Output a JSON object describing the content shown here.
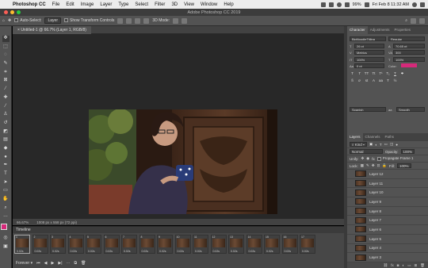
{
  "menubar": {
    "app_name": "Photoshop CC",
    "items": [
      "File",
      "Edit",
      "Image",
      "Layer",
      "Type",
      "Select",
      "Filter",
      "3D",
      "View",
      "Window",
      "Help"
    ],
    "battery": "99%",
    "clock": "Fri Feb 8  11:32 AM"
  },
  "window": {
    "title": "Adobe Photoshop CC 2019"
  },
  "options_bar": {
    "auto_select_label": "Auto-Select:",
    "auto_select_value": "Layer",
    "show_transform_label": "Show Transform Controls",
    "mode_3d_label": "3D Mode:"
  },
  "document": {
    "tab_title": "Untitled-1 @ 66.7% (Layer 1, RGB/8)",
    "zoom": "66.67%",
    "doc_info": "1008 px x 558 px (72 ppi)"
  },
  "timeline": {
    "title": "Timeline",
    "frames": [
      {
        "num": "1",
        "delay": "0.02s"
      },
      {
        "num": "2",
        "delay": "0.02s"
      },
      {
        "num": "3",
        "delay": "0.02s"
      },
      {
        "num": "4",
        "delay": "0.02s"
      },
      {
        "num": "5",
        "delay": "0.02s"
      },
      {
        "num": "6",
        "delay": "0.02s"
      },
      {
        "num": "7",
        "delay": "0.02s"
      },
      {
        "num": "8",
        "delay": "0.02s"
      },
      {
        "num": "9",
        "delay": "0.02s"
      },
      {
        "num": "10",
        "delay": "0.02s"
      },
      {
        "num": "11",
        "delay": "0.02s"
      },
      {
        "num": "12",
        "delay": "0.02s"
      },
      {
        "num": "13",
        "delay": "0.02s"
      },
      {
        "num": "14",
        "delay": "0.02s"
      },
      {
        "num": "15",
        "delay": "0.02s"
      },
      {
        "num": "16",
        "delay": "0.02s"
      },
      {
        "num": "17",
        "delay": "0.02s"
      }
    ],
    "loop_label": "Forever"
  },
  "character_panel": {
    "tabs": [
      "Character",
      "Adjustments",
      "Properties"
    ],
    "font_family": "BigNoodleTitling",
    "font_style": "Regular",
    "font_size": "26 pt",
    "leading": "70.65 pt",
    "kerning": "Metrics",
    "tracking": "300",
    "vertical_scale": "100%",
    "horizontal_scale": "100%",
    "baseline_shift": "0 pt",
    "color_label": "Color:",
    "language": "Spanish",
    "antialias": "Smooth",
    "swatch_color": "#d6297a"
  },
  "layers_panel": {
    "tabs": [
      "Layers",
      "Channels",
      "Paths"
    ],
    "filter_kind": "Kind",
    "blend_mode": "Normal",
    "opacity_label": "Opacity:",
    "opacity_value": "100%",
    "unify_label": "Unify:",
    "propagate_label": "Propagate Frame 1",
    "lock_label": "Lock:",
    "fill_label": "Fill:",
    "fill_value": "100%",
    "layers": [
      "Layer 12",
      "Layer 11",
      "Layer 10",
      "Layer 9",
      "Layer 8",
      "Layer 7",
      "Layer 6",
      "Layer 5",
      "Layer 4",
      "Layer 3",
      "Layer 2",
      "Layer 1"
    ]
  }
}
